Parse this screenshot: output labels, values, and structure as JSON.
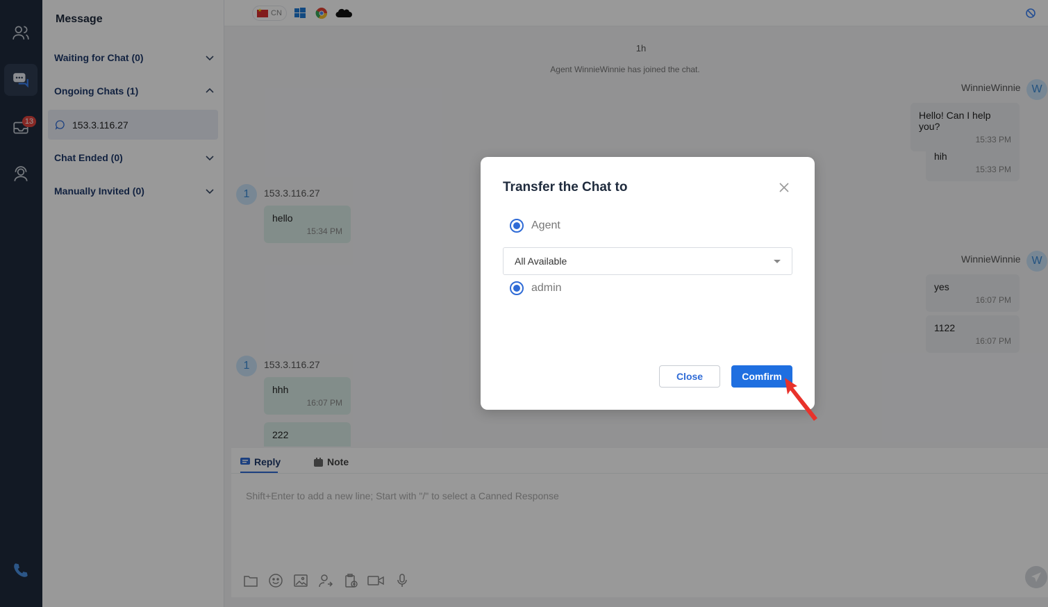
{
  "sidebar": {
    "badge_count": "13"
  },
  "panel": {
    "title": "Message",
    "groups": [
      {
        "label": "Waiting for Chat (0)"
      },
      {
        "label": "Ongoing Chats (1)"
      },
      {
        "label": "Chat Ended (0)"
      },
      {
        "label": "Manually Invited (0)"
      }
    ],
    "active_chat": "153.3.116.27"
  },
  "topbar": {
    "country": "CN"
  },
  "chat": {
    "elapsed": "1h",
    "system_message": "Agent WinnieWinnie has joined the chat.",
    "agent_name": "WinnieWinnie",
    "agent_initial": "W",
    "visitor_name": "153.3.116.27",
    "visitor_initial": "1",
    "agent_block_1": [
      {
        "text": "Hello! Can I help you?",
        "time": "15:33 PM"
      },
      {
        "text": "hih",
        "time": "15:33 PM"
      }
    ],
    "visitor_block_1": [
      {
        "text": "hello",
        "time": "15:34 PM"
      }
    ],
    "agent_block_2": [
      {
        "text": "yes",
        "time": "16:07 PM"
      },
      {
        "text": "1122",
        "time": "16:07 PM"
      }
    ],
    "visitor_block_2": [
      {
        "text": "hhh",
        "time": "16:07 PM"
      },
      {
        "text": "222",
        "time": ""
      }
    ]
  },
  "composer": {
    "tab_reply": "Reply",
    "tab_note": "Note",
    "placeholder": "Shift+Enter to add a new line; Start with \"/\" to select a Canned Response"
  },
  "modal": {
    "title": "Transfer the Chat to",
    "option_agent": "Agent",
    "select_value": "All Available",
    "option_admin": "admin",
    "close_label": "Close",
    "confirm_label": "Comfirm"
  },
  "colors": {
    "rail": "#1f2b3d",
    "accent": "#1f6fe0",
    "badge": "#e0443f",
    "annotation_arrow": "#e8322b"
  }
}
